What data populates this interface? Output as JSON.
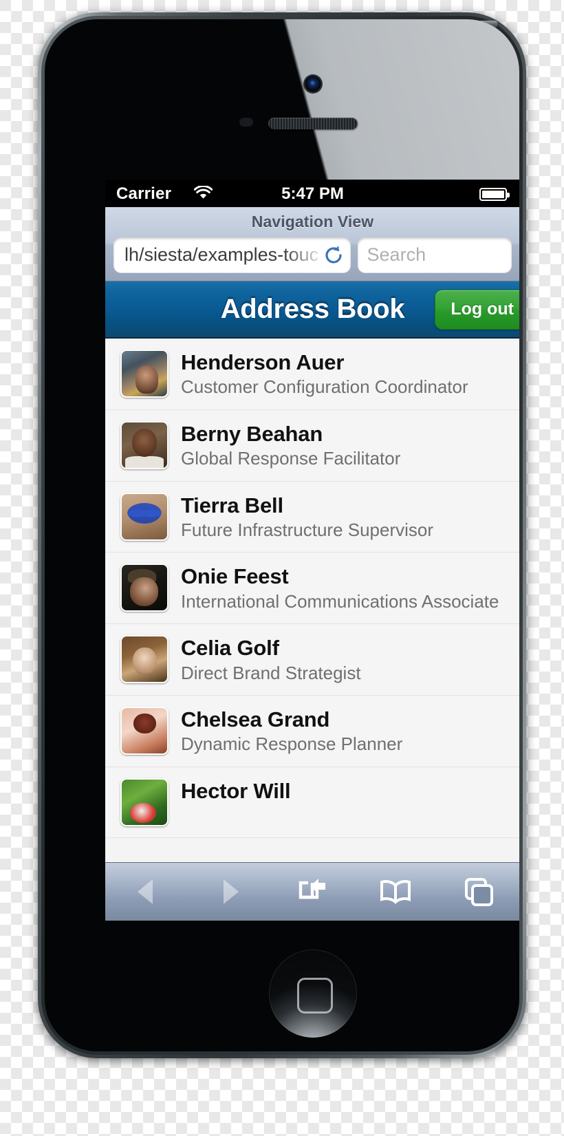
{
  "status_bar": {
    "carrier": "Carrier",
    "wifi_icon": "wifi-icon",
    "time": "5:47 PM",
    "battery_icon": "battery-full-icon"
  },
  "browser": {
    "nav_title": "Navigation View",
    "url_value": "lh/siesta/examples-touch",
    "reload_icon": "reload-icon",
    "search_placeholder": "Search",
    "search_value": "",
    "toolbar": {
      "back_label": "back-icon",
      "forward_label": "forward-icon",
      "share_label": "share-icon",
      "bookmarks_label": "bookmarks-icon",
      "tabs_label": "tabs-icon"
    }
  },
  "app": {
    "title": "Address Book",
    "logout_label": "Log out",
    "accent_blue": "#0a5a93",
    "accent_green": "#33a233",
    "contacts": [
      {
        "name": "Henderson Auer",
        "title": "Customer Configuration Coordinator",
        "avatar": "avatar-henderson-auer"
      },
      {
        "name": "Berny Beahan",
        "title": "Global Response Facilitator",
        "avatar": "avatar-berny-beahan"
      },
      {
        "name": "Tierra Bell",
        "title": "Future Infrastructure Supervisor",
        "avatar": "avatar-tierra-bell"
      },
      {
        "name": "Onie Feest",
        "title": "International Communications Associate",
        "avatar": "avatar-onie-feest"
      },
      {
        "name": "Celia Golf",
        "title": "Direct Brand Strategist",
        "avatar": "avatar-celia-golf"
      },
      {
        "name": "Chelsea Grand",
        "title": "Dynamic Response Planner",
        "avatar": "avatar-chelsea-grand"
      },
      {
        "name": "Hector Will",
        "title": "",
        "avatar": "avatar-hector-will"
      }
    ]
  }
}
